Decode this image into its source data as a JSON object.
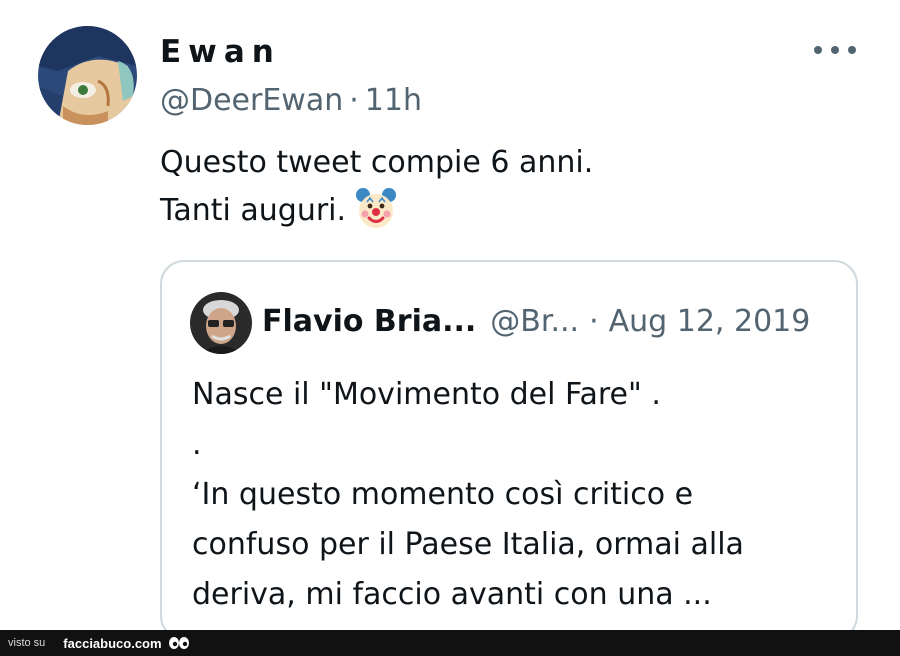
{
  "tweet": {
    "author_name": "Ewan",
    "author_handle": "@DeerEwan",
    "separator": "·",
    "time": "11h",
    "text_line1": "Questo tweet compie 6 anni.",
    "text_line2": "Tanti auguri.",
    "emoji": "clown-face-emoji",
    "more_icon": "more-horizontal-icon"
  },
  "quoted_tweet": {
    "author_name": "Flavio Bria...",
    "author_handle": "@Br...",
    "separator": "·",
    "date": "Aug 12, 2019",
    "lines": [
      "Nasce il \"Movimento del Fare\" .",
      ".",
      "‘In questo momento così critico e",
      "confuso per il Paese Italia, ormai alla",
      "deriva, mi faccio avanti con una ..."
    ]
  },
  "watermark": {
    "prefix": "visto su",
    "site": "facciabuco.com"
  },
  "colors": {
    "text_primary": "#0f1419",
    "text_secondary": "#536471",
    "border": "#cfd9de",
    "footer_bg": "#111111"
  }
}
